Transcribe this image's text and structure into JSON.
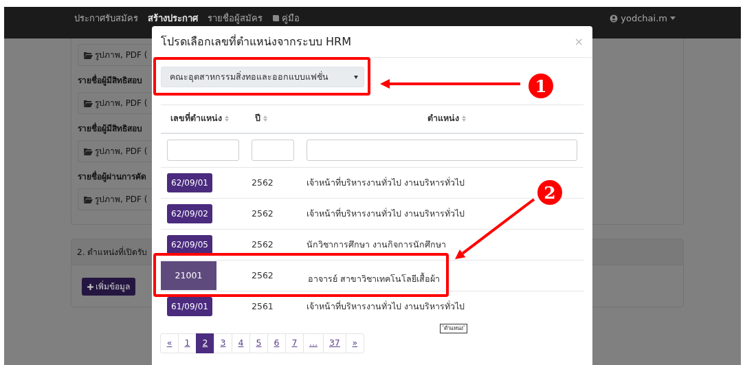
{
  "navbar": {
    "items": [
      {
        "label": "ประกาศรับสมัคร",
        "active": false
      },
      {
        "label": "สร้างประกาศ",
        "active": true
      },
      {
        "label": "รายชื่อผู้สมัคร",
        "active": false
      },
      {
        "label": "คู่มือ",
        "active": false,
        "kind": "book"
      }
    ],
    "user": "yodchai.m"
  },
  "page": {
    "uploads": [
      {
        "file_button": "รูปภาพ, PDF ("
      },
      {
        "label": "รายชื่อผู้มีสิทธิสอบ",
        "file_button": "รูปภาพ, PDF ("
      },
      {
        "label": "รายชื่อผู้มีสิทธิสอบ",
        "file_button": "รูปภาพ, PDF ("
      },
      {
        "label": "รายชื่อผู้ผ่านการคัด",
        "file_button": "รูปภาพ, PDF ("
      }
    ],
    "section_2": {
      "title": "2. ตำแหน่งที่เปิดรับ",
      "add_button": "เพิ่มข้อมูล"
    }
  },
  "modal": {
    "title": "โปรดเลือกเลขที่ตำแหน่งจากระบบ HRM",
    "close": "×",
    "select": {
      "value": "คณะอุตสาหกรรมสิ่งทอและออกแบบแฟชั่น"
    },
    "table": {
      "columns": [
        {
          "label": "เลขที่ตำแหน่ง"
        },
        {
          "label": "ปี"
        },
        {
          "label": "ตำแหน่ง"
        }
      ],
      "rows": [
        {
          "code": "62/09/01",
          "year": "2562",
          "position": "เจ้าหน้าที่บริหารงานทั่วไป งานบริหารทั่วไป",
          "selected": false
        },
        {
          "code": "62/09/02",
          "year": "2562",
          "position": "เจ้าหน้าที่บริหารงานทั่วไป งานบริหารทั่วไป",
          "selected": false
        },
        {
          "code": "62/09/05",
          "year": "2562",
          "position": "นักวิชาการศึกษา งานกิจการนักศึกษา",
          "selected": false
        },
        {
          "code": "21001",
          "year": "2562",
          "position": "อาจารย์ สาขาวิชาเทคโนโลยีเสื้อผ้า",
          "selected": true
        },
        {
          "code": "61/09/01",
          "year": "2561",
          "position": "เจ้าหน้าที่บริหารงานทั่วไป งานบริหารทั่วไป",
          "selected": false
        }
      ]
    },
    "pagination": [
      {
        "label": "«",
        "selected": false
      },
      {
        "label": "1",
        "selected": false
      },
      {
        "label": "2",
        "selected": true
      },
      {
        "label": "3",
        "selected": false
      },
      {
        "label": "4",
        "selected": false
      },
      {
        "label": "5",
        "selected": false
      },
      {
        "label": "6",
        "selected": false
      },
      {
        "label": "7",
        "selected": false
      },
      {
        "label": "...",
        "selected": false
      },
      {
        "label": "37",
        "selected": false
      },
      {
        "label": "»",
        "selected": false
      }
    ],
    "tooltip": "'ตำแหน่ง'"
  },
  "annotations": [
    {
      "label": "1"
    },
    {
      "label": "2"
    }
  ]
}
